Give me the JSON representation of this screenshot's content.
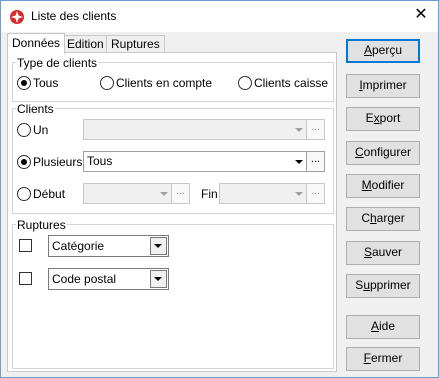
{
  "window": {
    "title": "Liste des clients",
    "close_glyph": "✕",
    "icon": "app-flag-icon"
  },
  "tabs": [
    {
      "label": "Données",
      "active": true
    },
    {
      "label": "Edition",
      "active": false
    },
    {
      "label": "Ruptures",
      "active": false
    }
  ],
  "type_clients": {
    "label": "Type de clients",
    "options": [
      {
        "label": "Tous",
        "selected": true
      },
      {
        "label": "Clients en compte",
        "selected": false
      },
      {
        "label": "Clients caisse",
        "selected": false
      }
    ]
  },
  "clients": {
    "label": "Clients",
    "un": {
      "label": "Un",
      "selected": false,
      "value": ""
    },
    "plusieurs": {
      "label": "Plusieurs",
      "selected": true,
      "value": "Tous"
    },
    "debut": {
      "label": "Début",
      "selected": false,
      "value": ""
    },
    "fin": {
      "label": "Fin",
      "value": ""
    },
    "dots_label": "..."
  },
  "ruptures": {
    "label": "Ruptures",
    "rows": [
      {
        "checked": false,
        "value": "Catégorie"
      },
      {
        "checked": false,
        "value": "Code postal"
      }
    ]
  },
  "buttons": {
    "apercu": {
      "mn": "A",
      "rest": "perçu"
    },
    "imprimer": {
      "mn": "I",
      "rest": "mprimer"
    },
    "export": {
      "pre": "E",
      "mn": "x",
      "rest": "port"
    },
    "configurer": {
      "mn": "C",
      "rest": "onfigurer"
    },
    "modifier": {
      "mn": "M",
      "rest": "odifier"
    },
    "charger": {
      "pre": "C",
      "mn": "h",
      "rest": "arger"
    },
    "sauver": {
      "mn": "S",
      "rest": "auver"
    },
    "supprimer": {
      "pre": "S",
      "mn": "u",
      "rest": "pprimer"
    },
    "aide": {
      "mn": "A",
      "rest": "ide"
    },
    "fermer": {
      "mn": "F",
      "rest": "ermer"
    }
  }
}
